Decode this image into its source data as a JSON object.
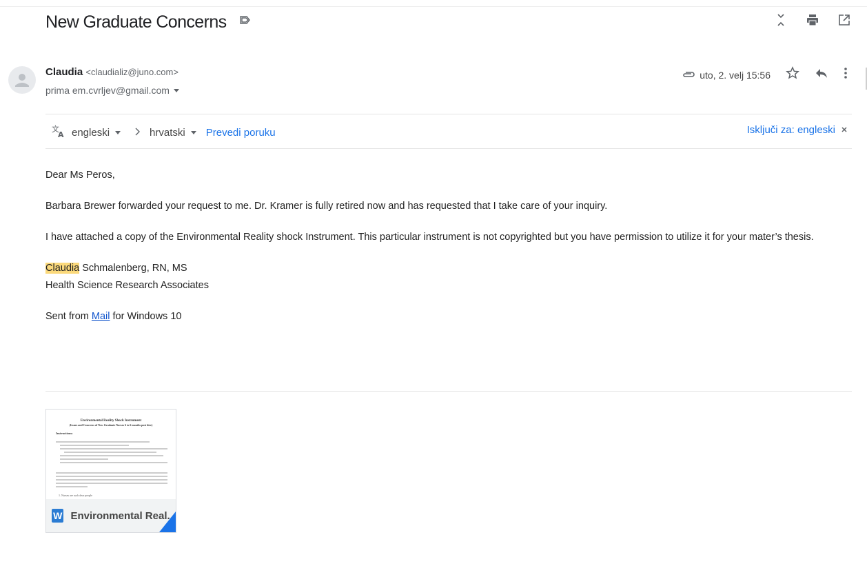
{
  "subject": {
    "title": "New Graduate Concerns"
  },
  "sender": {
    "name": "Claudia",
    "email": "<claudializ@juno.com>",
    "to": "prima em.cvrljev@gmail.com",
    "date": "uto, 2. velj 15:56"
  },
  "translate": {
    "from_lang": "engleski",
    "to_lang": "hrvatski",
    "translate_label": "Prevedi poruku",
    "turn_off_label": "Isključi za: engleski"
  },
  "body": {
    "greeting": "Dear Ms Peros,",
    "para1": "Barbara Brewer forwarded your request to me.  Dr. Kramer is fully retired now and has requested that I take care of your inquiry.",
    "para2": "I have attached a copy of the Environmental Reality shock Instrument.  This particular instrument is not copyrighted but you have permission to utilize it for your mater’s thesis.",
    "sig_name_highlight": "Claudia",
    "sig_name_rest": " Schmalenberg, RN, MS",
    "sig_org": "Health Science Research Associates",
    "sent_prefix": "Sent from ",
    "sent_link": "Mail",
    "sent_suffix": " for Windows 10"
  },
  "attachment": {
    "badge": "W",
    "name": "Environmental Real...",
    "preview_title": "Environmental Reality Shock Instrument",
    "preview_subtitle": "(Issues and Concerns of New Graduate Nurses 6 to 6 months post hire)",
    "preview_section": "Instructions:",
    "preview_item": "1.  Nurses are such dear people"
  },
  "colors": {
    "link": "#1a73e8",
    "highlight": "#fbd97b",
    "word_blue": "#2b7cd3"
  },
  "icons": [
    "label-icon",
    "expand-collapse-icon",
    "print-icon",
    "new-window-icon",
    "attachment-icon",
    "star-icon",
    "reply-icon",
    "more-vert-icon",
    "translate-icon",
    "chevron-right-icon",
    "close-icon",
    "word-icon"
  ]
}
